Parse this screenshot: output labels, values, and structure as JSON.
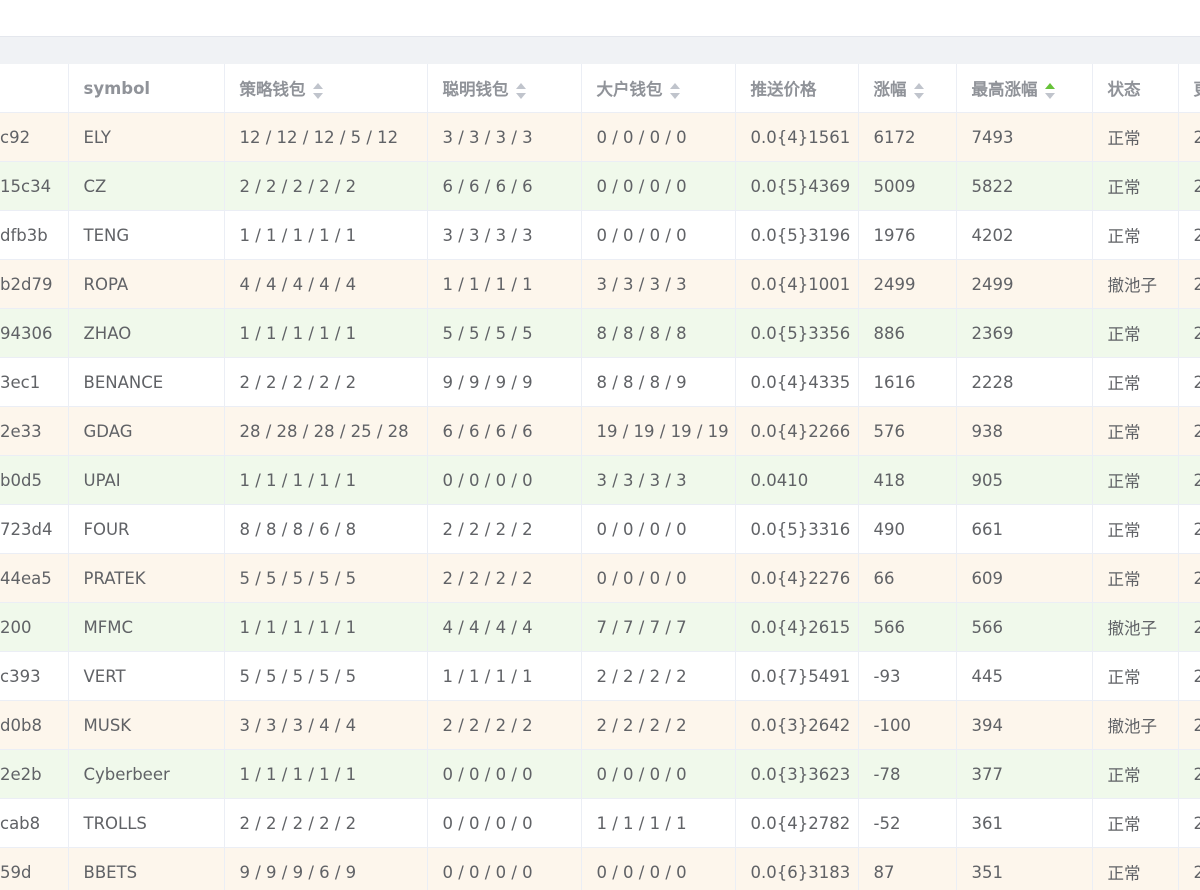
{
  "table": {
    "columns": [
      {
        "label": "",
        "sortable": false
      },
      {
        "label": "symbol",
        "sortable": false
      },
      {
        "label": "策略钱包",
        "sortable": true
      },
      {
        "label": "聪明钱包",
        "sortable": true
      },
      {
        "label": "大户钱包",
        "sortable": true
      },
      {
        "label": "推送价格",
        "sortable": false
      },
      {
        "label": "涨幅",
        "sortable": true
      },
      {
        "label": "最高涨幅",
        "sortable": true,
        "sort_state": "ascending"
      },
      {
        "label": "状态",
        "sortable": false
      },
      {
        "label": "更",
        "sortable": false
      }
    ],
    "rows": [
      {
        "id": "c92",
        "symbol": "ELY",
        "strategy": "12 / 12 / 12 / 5 / 12",
        "smart": "3 / 3 / 3 / 3",
        "whale": "0 / 0 / 0 / 0",
        "price": "0.0{4}1561",
        "change": "6172",
        "max_change": "7493",
        "status": "正常",
        "last": "2",
        "tone": "orange"
      },
      {
        "id": "15c34",
        "symbol": "CZ",
        "strategy": "2 / 2 / 2 / 2 / 2",
        "smart": "6 / 6 / 6 / 6",
        "whale": "0 / 0 / 0 / 0",
        "price": "0.0{5}4369",
        "change": "5009",
        "max_change": "5822",
        "status": "正常",
        "last": "2",
        "tone": "green"
      },
      {
        "id": "dfb3b",
        "symbol": "TENG",
        "strategy": "1 / 1 / 1 / 1 / 1",
        "smart": "3 / 3 / 3 / 3",
        "whale": "0 / 0 / 0 / 0",
        "price": "0.0{5}3196",
        "change": "1976",
        "max_change": "4202",
        "status": "正常",
        "last": "2",
        "tone": "white"
      },
      {
        "id": "b2d79",
        "symbol": "ROPA",
        "strategy": "4 / 4 / 4 / 4 / 4",
        "smart": "1 / 1 / 1 / 1",
        "whale": "3 / 3 / 3 / 3",
        "price": "0.0{4}1001",
        "change": "2499",
        "max_change": "2499",
        "status": "撤池子",
        "last": "2",
        "tone": "orange"
      },
      {
        "id": "94306",
        "symbol": "ZHAO",
        "strategy": "1 / 1 / 1 / 1 / 1",
        "smart": "5 / 5 / 5 / 5",
        "whale": "8 / 8 / 8 / 8",
        "price": "0.0{5}3356",
        "change": "886",
        "max_change": "2369",
        "status": "正常",
        "last": "2",
        "tone": "green"
      },
      {
        "id": "3ec1",
        "symbol": "BENANCE",
        "strategy": "2 / 2 / 2 / 2 / 2",
        "smart": "9 / 9 / 9 / 9",
        "whale": "8 / 8 / 8 / 9",
        "price": "0.0{4}4335",
        "change": "1616",
        "max_change": "2228",
        "status": "正常",
        "last": "2",
        "tone": "white"
      },
      {
        "id": "2e33",
        "symbol": "GDAG",
        "strategy": "28 / 28 / 28 / 25 / 28",
        "smart": "6 / 6 / 6 / 6",
        "whale": "19 / 19 / 19 / 19",
        "price": "0.0{4}2266",
        "change": "576",
        "max_change": "938",
        "status": "正常",
        "last": "2",
        "tone": "orange"
      },
      {
        "id": "b0d5",
        "symbol": "UPAI",
        "strategy": "1 / 1 / 1 / 1 / 1",
        "smart": "0 / 0 / 0 / 0",
        "whale": "3 / 3 / 3 / 3",
        "price": "0.0410",
        "change": "418",
        "max_change": "905",
        "status": "正常",
        "last": "2",
        "tone": "green"
      },
      {
        "id": "723d4",
        "symbol": "FOUR",
        "strategy": "8 / 8 / 8 / 6 / 8",
        "smart": "2 / 2 / 2 / 2",
        "whale": "0 / 0 / 0 / 0",
        "price": "0.0{5}3316",
        "change": "490",
        "max_change": "661",
        "status": "正常",
        "last": "2",
        "tone": "white"
      },
      {
        "id": "44ea5",
        "symbol": "PRATEK",
        "strategy": "5 / 5 / 5 / 5 / 5",
        "smart": "2 / 2 / 2 / 2",
        "whale": "0 / 0 / 0 / 0",
        "price": "0.0{4}2276",
        "change": "66",
        "max_change": "609",
        "status": "正常",
        "last": "2",
        "tone": "orange"
      },
      {
        "id": "200",
        "symbol": "MFMC",
        "strategy": "1 / 1 / 1 / 1 / 1",
        "smart": "4 / 4 / 4 / 4",
        "whale": "7 / 7 / 7 / 7",
        "price": "0.0{4}2615",
        "change": "566",
        "max_change": "566",
        "status": "撤池子",
        "last": "2",
        "tone": "green"
      },
      {
        "id": "c393",
        "symbol": "VERT",
        "strategy": "5 / 5 / 5 / 5 / 5",
        "smart": "1 / 1 / 1 / 1",
        "whale": "2 / 2 / 2 / 2",
        "price": "0.0{7}5491",
        "change": "-93",
        "max_change": "445",
        "status": "正常",
        "last": "2",
        "tone": "white"
      },
      {
        "id": "d0b8",
        "symbol": "MUSK",
        "strategy": "3 / 3 / 3 / 4 / 4",
        "smart": "2 / 2 / 2 / 2",
        "whale": "2 / 2 / 2 / 2",
        "price": "0.0{3}2642",
        "change": "-100",
        "max_change": "394",
        "status": "撤池子",
        "last": "2",
        "tone": "orange"
      },
      {
        "id": "2e2b",
        "symbol": "Cyberbeer",
        "strategy": "1 / 1 / 1 / 1 / 1",
        "smart": "0 / 0 / 0 / 0",
        "whale": "0 / 0 / 0 / 0",
        "price": "0.0{3}3623",
        "change": "-78",
        "max_change": "377",
        "status": "正常",
        "last": "2",
        "tone": "green"
      },
      {
        "id": "cab8",
        "symbol": "TROLLS",
        "strategy": "2 / 2 / 2 / 2 / 2",
        "smart": "0 / 0 / 0 / 0",
        "whale": "1 / 1 / 1 / 1",
        "price": "0.0{4}2782",
        "change": "-52",
        "max_change": "361",
        "status": "正常",
        "last": "2",
        "tone": "white"
      },
      {
        "id": "59d",
        "symbol": "BBETS",
        "strategy": "9 / 9 / 9 / 6 / 9",
        "smart": "0 / 0 / 0 / 0",
        "whale": "0 / 0 / 0 / 0",
        "price": "0.0{6}3183",
        "change": "87",
        "max_change": "351",
        "status": "正常",
        "last": "2",
        "tone": "orange"
      }
    ]
  }
}
